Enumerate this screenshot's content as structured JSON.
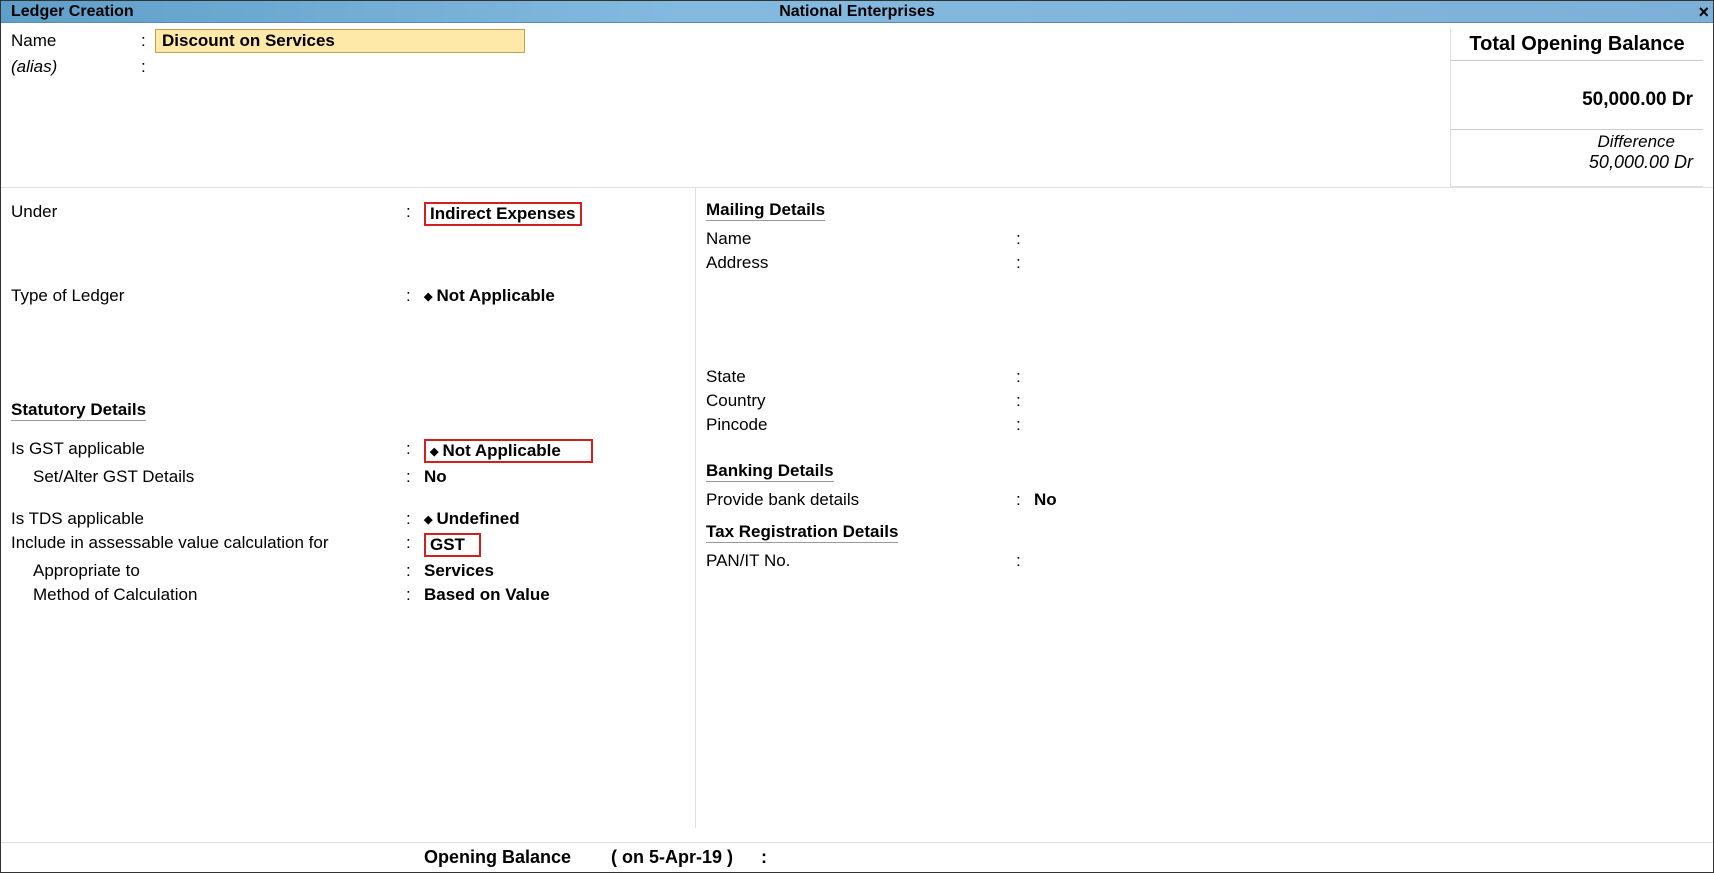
{
  "titlebar": {
    "screen": "Ledger Creation",
    "company": "National Enterprises",
    "close": "×"
  },
  "name_section": {
    "name_label": "Name",
    "name_value": "Discount on Services",
    "alias_label": "(alias)",
    "alias_value": ""
  },
  "balance_panel": {
    "title": "Total Opening Balance",
    "amount": "50,000.00 Dr",
    "diff_label": "Difference",
    "diff_amount": "50,000.00 Dr"
  },
  "left": {
    "under_label": "Under",
    "under_value": "Indirect Expenses",
    "type_ledger_label": "Type of Ledger",
    "type_ledger_value": "Not Applicable",
    "statutory_head": "Statutory Details",
    "gst_applicable_label": "Is GST applicable",
    "gst_applicable_value": "Not Applicable",
    "set_alter_gst_label": "Set/Alter GST Details",
    "set_alter_gst_value": "No",
    "tds_applicable_label": "Is TDS applicable",
    "tds_applicable_value": "Undefined",
    "include_assessable_label": "Include in assessable value calculation for",
    "include_assessable_value": "GST",
    "appropriate_to_label": "Appropriate to",
    "appropriate_to_value": "Services",
    "method_calc_label": "Method of Calculation",
    "method_calc_value": "Based on Value"
  },
  "right": {
    "mailing_head": "Mailing Details",
    "name_label": "Name",
    "name_value": "",
    "address_label": "Address",
    "address_value": "",
    "state_label": "State",
    "state_value": "",
    "country_label": "Country",
    "country_value": "",
    "pincode_label": "Pincode",
    "pincode_value": "",
    "banking_head": "Banking Details",
    "bank_details_label": "Provide bank details",
    "bank_details_value": "No",
    "tax_reg_head": "Tax Registration Details",
    "pan_label": "PAN/IT No.",
    "pan_value": ""
  },
  "footer": {
    "opening_balance_label": "Opening Balance",
    "on_date_label": "( on 5-Apr-19 )",
    "colon": ":"
  }
}
